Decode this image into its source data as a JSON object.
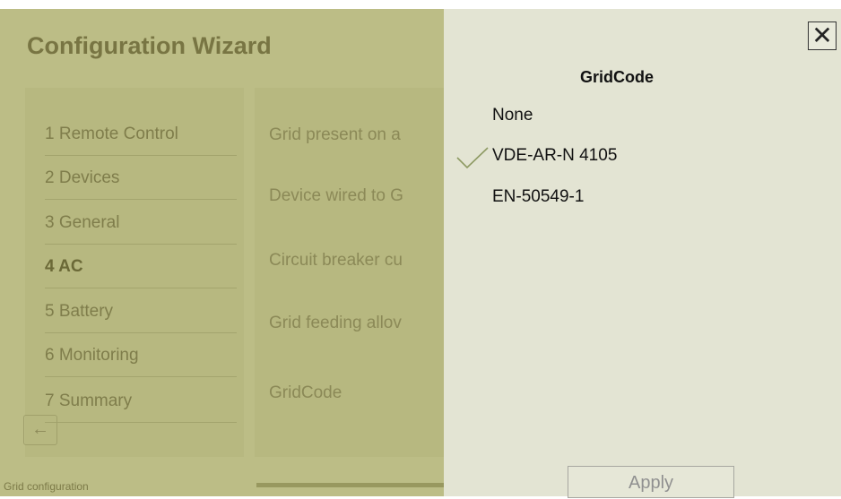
{
  "wizard": {
    "title": "Configuration Wizard",
    "steps": [
      {
        "label": "1 Remote Control"
      },
      {
        "label": "2 Devices"
      },
      {
        "label": "3 General"
      },
      {
        "label": "4 AC"
      },
      {
        "label": "5 Battery"
      },
      {
        "label": "6 Monitoring"
      },
      {
        "label": "7 Summary"
      }
    ],
    "active_step": "4 AC",
    "fields": [
      "Grid present on a",
      "Device wired to G",
      "Circuit breaker cu",
      "Grid feeding allov",
      "GridCode"
    ],
    "footer_label": "Grid configuration"
  },
  "dialog": {
    "title": "GridCode",
    "close_label": "✕",
    "options": [
      {
        "label": "None",
        "selected": false
      },
      {
        "label": "VDE-AR-N 4105",
        "selected": true
      },
      {
        "label": "EN-50549-1",
        "selected": false
      }
    ],
    "apply_label": "Apply"
  },
  "colors": {
    "overlay": "#bcbd86",
    "dialog_bg": "#e3e4d3",
    "check": "#8e9a63"
  }
}
